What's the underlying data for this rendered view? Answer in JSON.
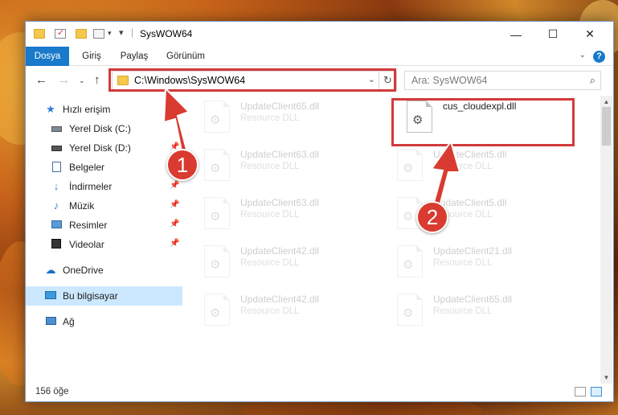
{
  "window": {
    "title": "SysWOW64",
    "controls": {
      "minimize": "—",
      "maximize": "☐",
      "close": "✕"
    }
  },
  "ribbon": {
    "tabs": [
      "Dosya",
      "Giriş",
      "Paylaş",
      "Görünüm"
    ],
    "active_tab": "Dosya",
    "help": "?"
  },
  "address_bar": {
    "path": "C:\\Windows\\SysWOW64",
    "search_placeholder": "Ara: SysWOW64"
  },
  "sidebar": {
    "items": [
      {
        "label": "Hızlı erişim",
        "icon": "star-icon",
        "pinned": false
      },
      {
        "label": "Yerel Disk (C:)",
        "icon": "drive-icon",
        "pinned": false
      },
      {
        "label": "Yerel Disk (D:)",
        "icon": "drive-icon",
        "pinned": true
      },
      {
        "label": "Belgeler",
        "icon": "documents-icon",
        "pinned": true
      },
      {
        "label": "İndirmeler",
        "icon": "download-icon",
        "pinned": true
      },
      {
        "label": "Müzik",
        "icon": "music-icon",
        "pinned": true
      },
      {
        "label": "Resimler",
        "icon": "pictures-icon",
        "pinned": true
      },
      {
        "label": "Videolar",
        "icon": "video-icon",
        "pinned": true
      },
      {
        "label": "OneDrive",
        "icon": "cloud-icon",
        "pinned": false
      },
      {
        "label": "Bu bilgisayar",
        "icon": "computer-icon",
        "pinned": false,
        "selected": true
      },
      {
        "label": "Ağ",
        "icon": "network-icon",
        "pinned": false
      }
    ]
  },
  "files": [
    {
      "name": "UpdateClient65.dll",
      "type": "Resource DLL",
      "highlighted": false
    },
    {
      "name": "cus_cloudexpl.dll",
      "type": "",
      "highlighted": true
    },
    {
      "name": "UpdateClient63.dll",
      "type": "Resource DLL",
      "highlighted": false
    },
    {
      "name": "UpdateClient5.dll",
      "type": "Resource DLL",
      "highlighted": false
    },
    {
      "name": "UpdateClient63.dll",
      "type": "Resource DLL",
      "highlighted": false
    },
    {
      "name": "UpdateClient5.dll",
      "type": "Resource DLL",
      "highlighted": false
    },
    {
      "name": "UpdateClient42.dll",
      "type": "Resource DLL",
      "highlighted": false
    },
    {
      "name": "UpdateClient21.dll",
      "type": "Resource DLL",
      "highlighted": false
    },
    {
      "name": "UpdateClient42.dll",
      "type": "Resource DLL",
      "highlighted": false
    },
    {
      "name": "UpdateClient65.dll",
      "type": "Resource DLL",
      "highlighted": false
    }
  ],
  "status_bar": {
    "item_count": "156 öğe"
  },
  "annotations": {
    "step1": "1",
    "step2": "2",
    "color": "#d23a3a"
  }
}
